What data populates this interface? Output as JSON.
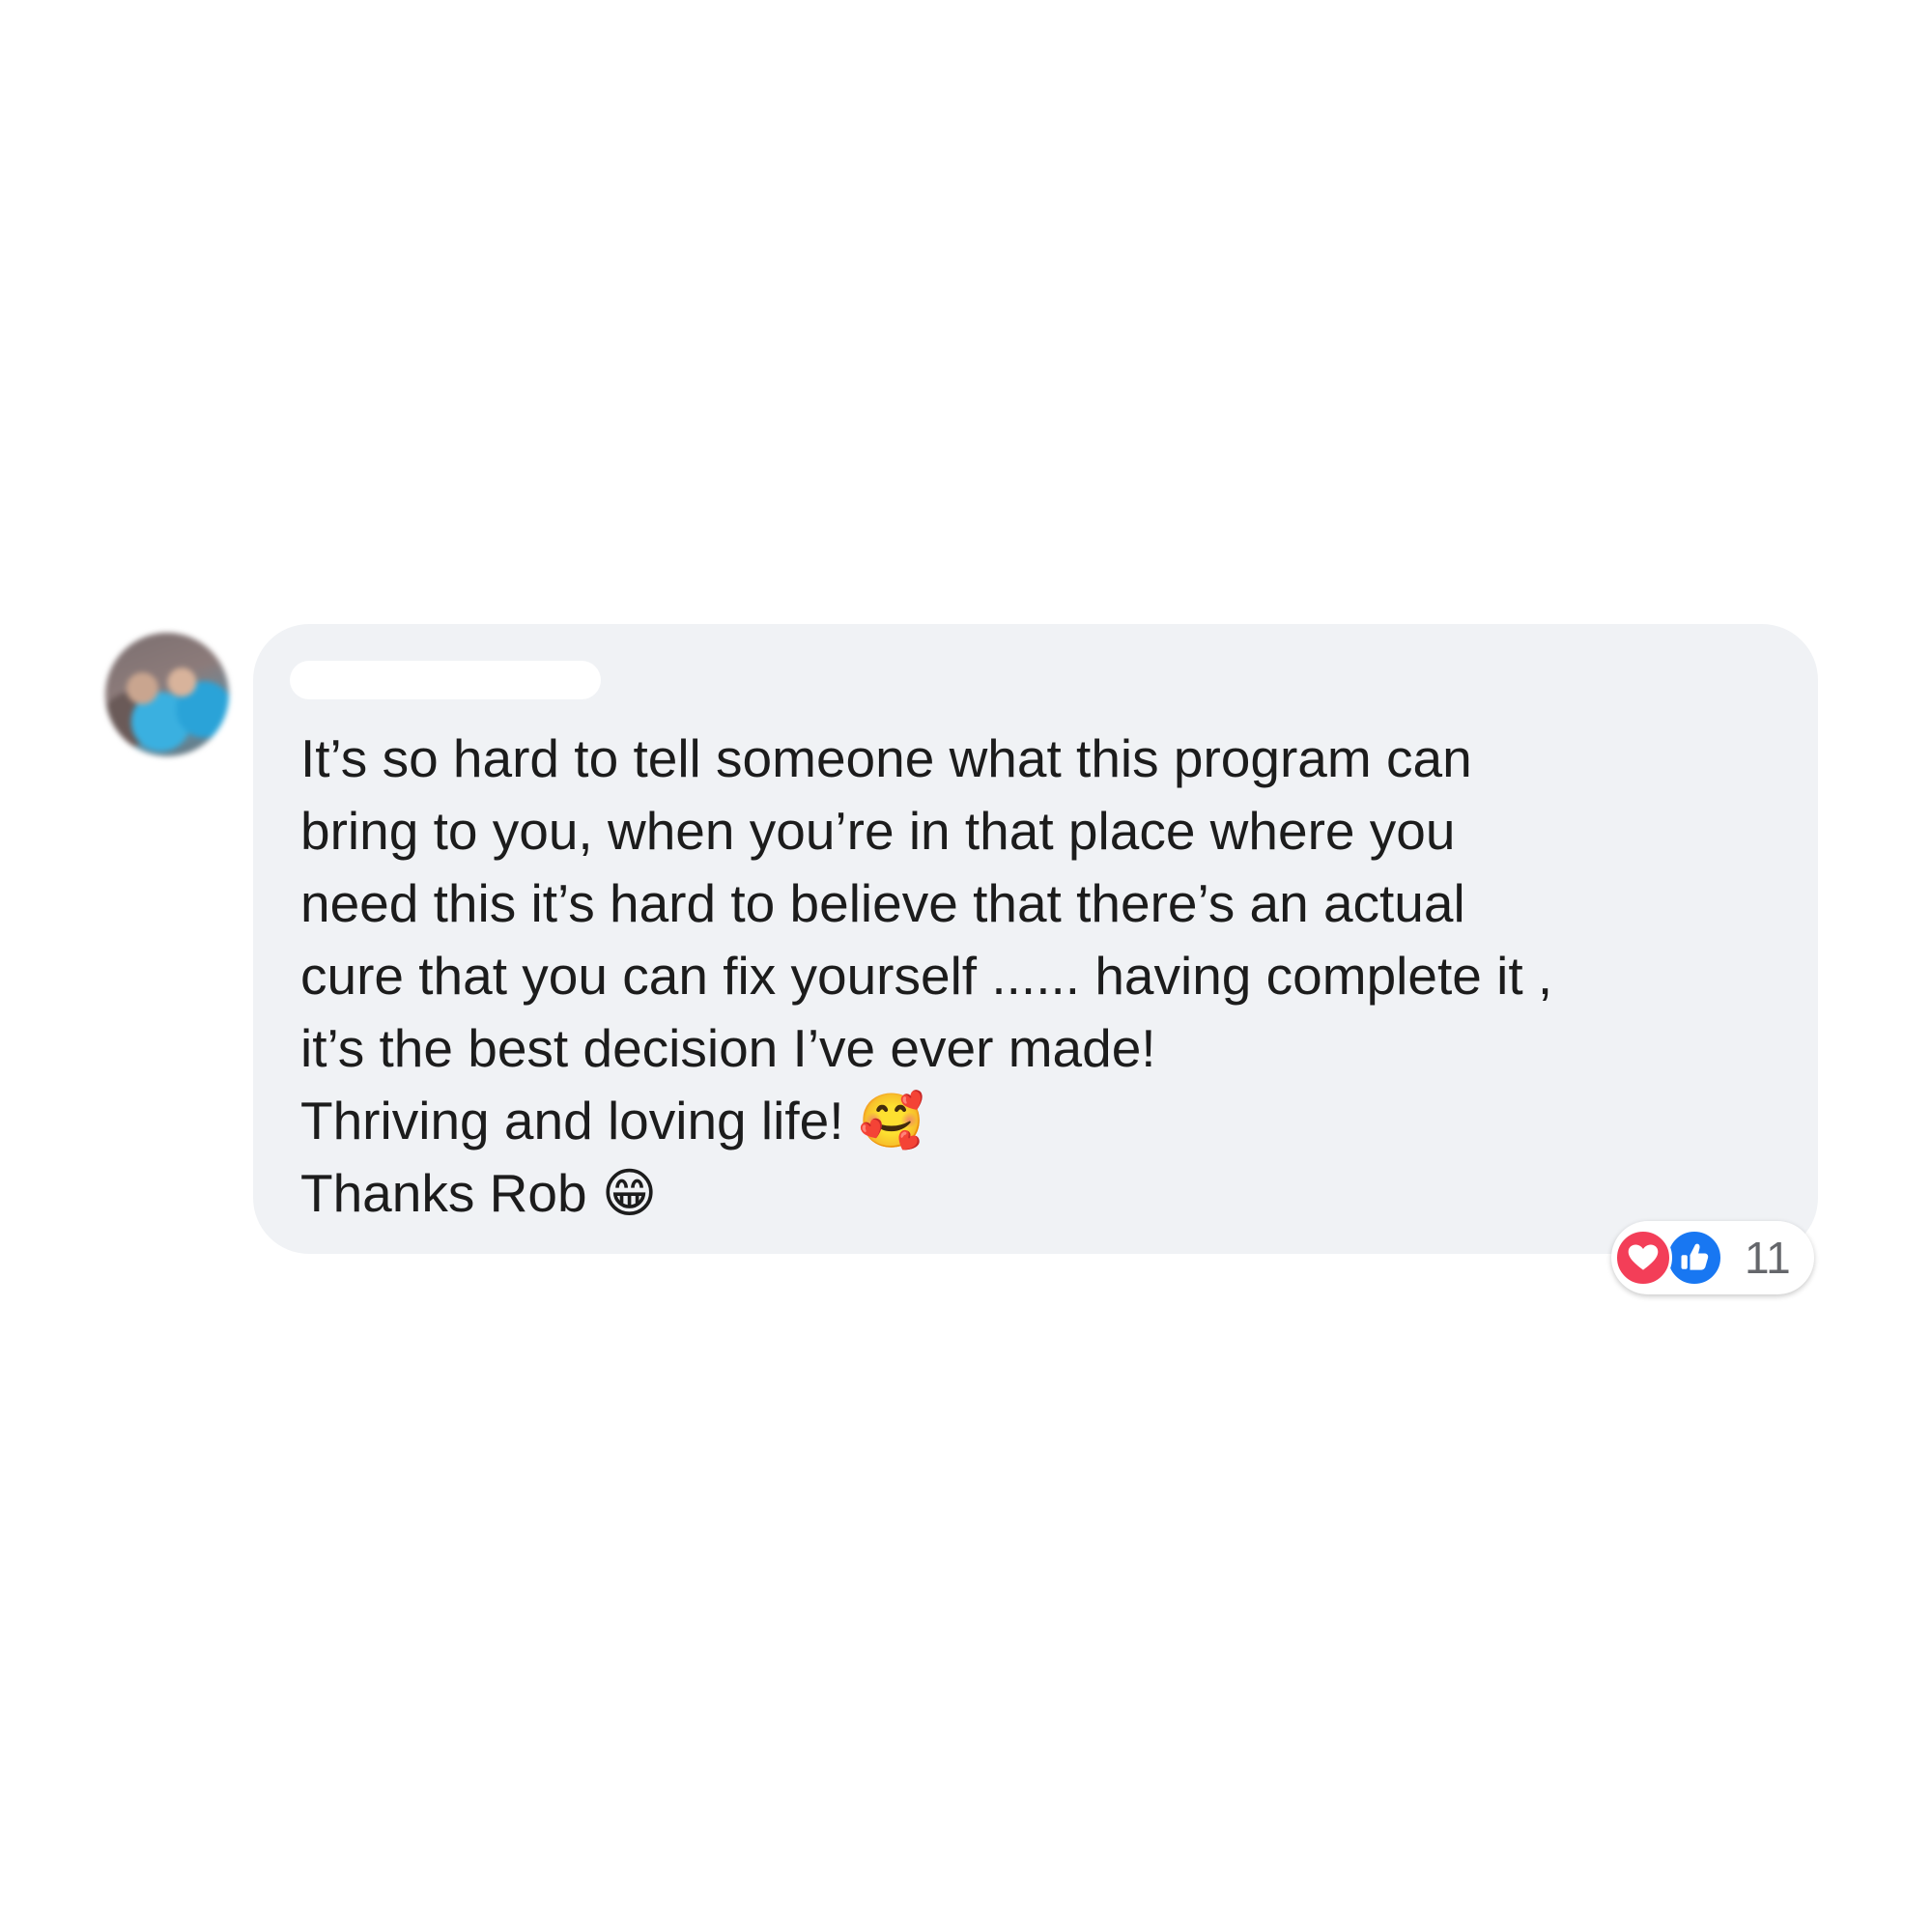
{
  "comment": {
    "author": "",
    "lines": [
      "It’s so hard to tell someone what this program can",
      "bring to you, when you’re in that place where you",
      "need this it’s hard to believe that there’s an actual",
      "cure that you can fix yourself ...... having complete it ,",
      "it’s the best decision I’ve ever made!"
    ],
    "line_thriving": "Thriving and loving life!",
    "emoji_thriving": "🥰",
    "line_thanks": "Thanks Rob",
    "emoji_thanks": "😁"
  },
  "reactions": {
    "types": [
      "love-icon",
      "like-icon"
    ],
    "count": "11"
  },
  "colors": {
    "bubble": "#f0f2f5",
    "love": "#f33e58",
    "like": "#1877f2",
    "count_text": "#65676b"
  }
}
